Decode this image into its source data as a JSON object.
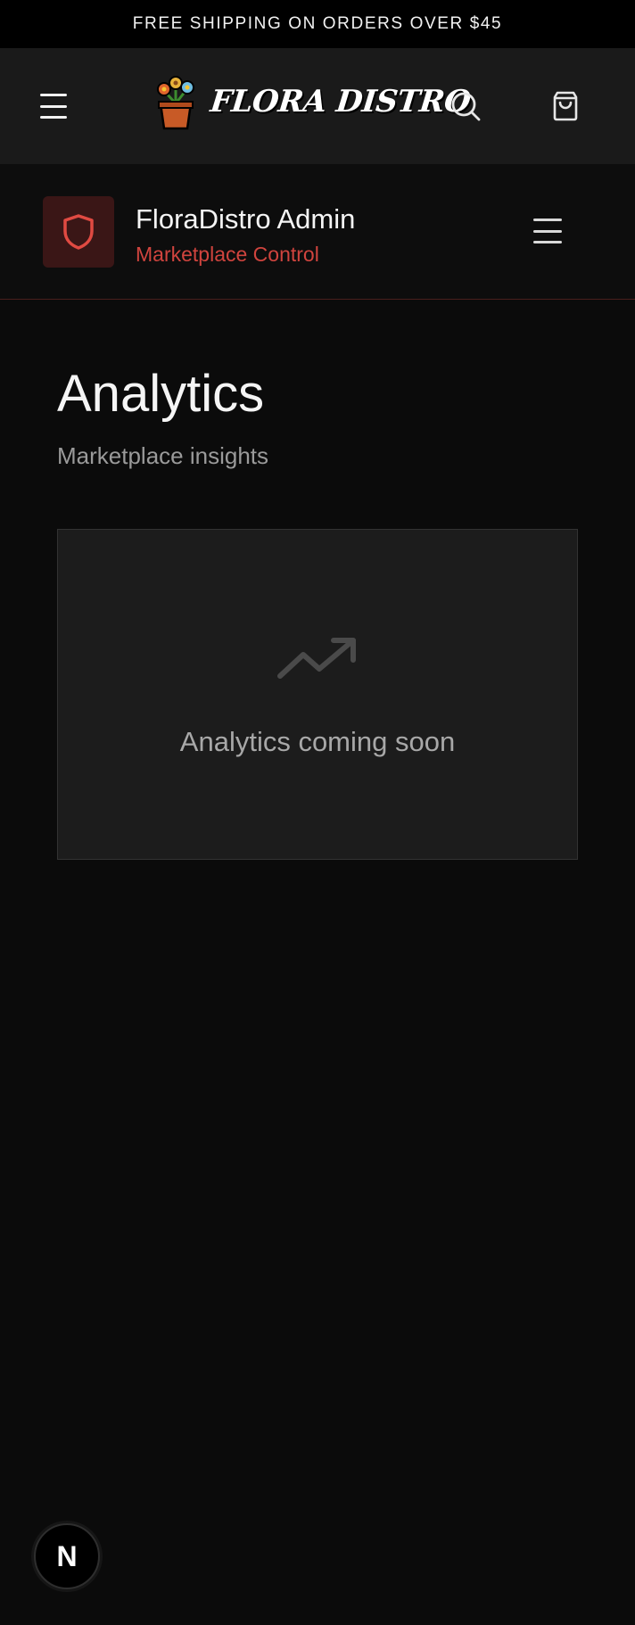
{
  "announcement": {
    "text": "FREE SHIPPING ON ORDERS OVER $45"
  },
  "header": {
    "logo_text": "FLORA DISTRO",
    "icons": [
      "menu-icon",
      "search-icon",
      "shopping-bag-icon"
    ]
  },
  "admin": {
    "title": "FloraDistro Admin",
    "subtitle": "Marketplace Control",
    "icons": [
      "shield-icon",
      "menu-icon"
    ]
  },
  "page": {
    "title": "Analytics",
    "subtitle": "Marketplace insights"
  },
  "placeholder": {
    "icon": "trending-up-icon",
    "text": "Analytics coming soon"
  },
  "dev_badge": {
    "label": "N"
  },
  "colors": {
    "accent": "#d0443e",
    "background": "#0b0b0b",
    "header_bg": "#1a1a1a",
    "card_bg": "#1c1c1c"
  }
}
